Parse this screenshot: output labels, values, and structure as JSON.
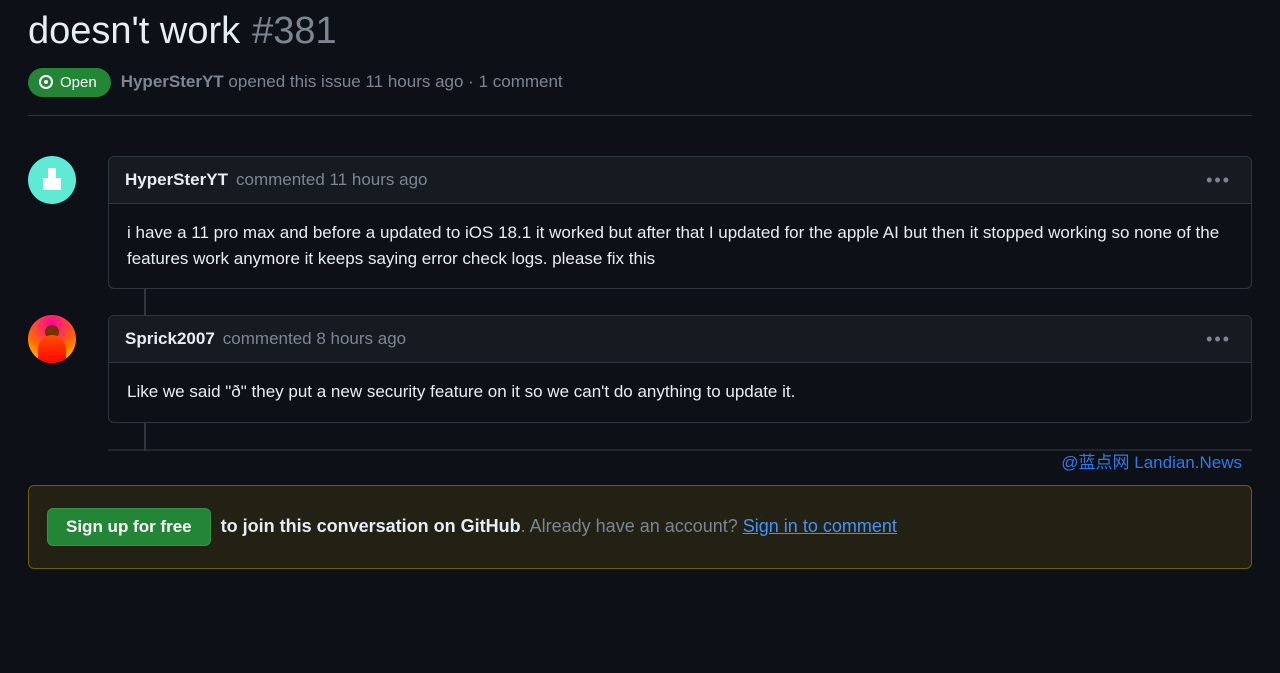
{
  "issue": {
    "title": "doesn't work",
    "number": "#381",
    "state": "Open",
    "author": "HyperSterYT",
    "opened_ago": "opened this issue 11 hours ago",
    "comment_count": "1 comment"
  },
  "comments": [
    {
      "author": "HyperSterYT",
      "timestamp": "commented 11 hours ago",
      "body": "i have a 11 pro max and before a updated to iOS 18.1 it worked but after that I updated for the apple AI but then it stopped working so none of the features work anymore it keeps saying error check logs. please fix this"
    },
    {
      "author": "Sprick2007",
      "timestamp": "commented 8 hours ago",
      "body": "Like we said \"ð\" they put a new security feature on it so we can't do anything to update it."
    }
  ],
  "signup": {
    "button": "Sign up for free",
    "join_text": "to join this conversation on GitHub",
    "already": ". Already have an account? ",
    "signin": "Sign in to comment"
  },
  "watermark": "@蓝点网 Landian.News"
}
